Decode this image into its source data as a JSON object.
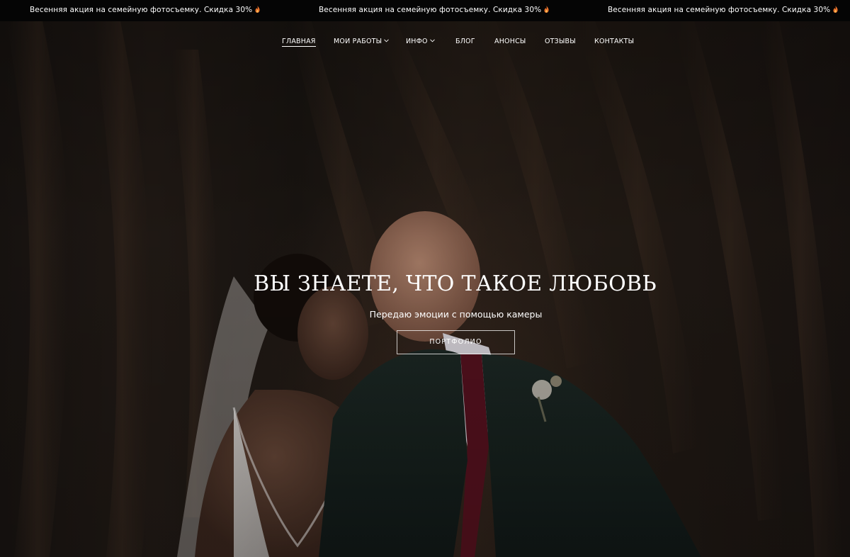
{
  "promo": {
    "items": [
      "Весенняя акция на семейную фотосъемку. Скидка 30%",
      "Весенняя акция на семейную фотосъемку. Скидка 30%",
      "Весенняя акция на семейную фотосъемку. Скидка 30%"
    ],
    "icon": "fire-icon",
    "background": "#050505",
    "text_color": "#ffffff"
  },
  "nav": {
    "items": [
      {
        "label": "ГЛАВНАЯ",
        "active": true,
        "has_dropdown": false
      },
      {
        "label": "МОИ РАБОТЫ",
        "active": false,
        "has_dropdown": true
      },
      {
        "label": "ИНФО",
        "active": false,
        "has_dropdown": true
      },
      {
        "label": "БЛОГ",
        "active": false,
        "has_dropdown": false
      },
      {
        "label": "АНОНСЫ",
        "active": false,
        "has_dropdown": false
      },
      {
        "label": "ОТЗЫВЫ",
        "active": false,
        "has_dropdown": false
      },
      {
        "label": "КОНТАКТЫ",
        "active": false,
        "has_dropdown": false
      }
    ]
  },
  "hero": {
    "title": "ВЫ ЗНАЕТЕ, ЧТО ТАКОЕ ЛЮБОВЬ",
    "subtitle": "Передаю эмоции с помощью камеры",
    "button_label": "ПОРТФОЛИО",
    "image_description_icon": "wedding-couple-photo"
  },
  "colors": {
    "text": "#ffffff",
    "accent_fire": "#e8712b"
  }
}
